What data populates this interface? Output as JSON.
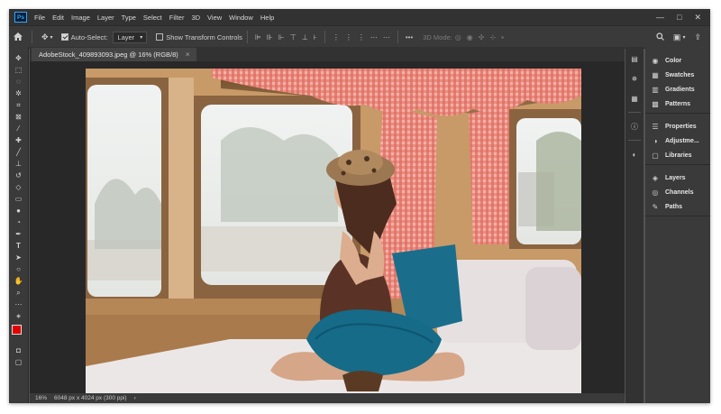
{
  "app": {
    "logo": "Ps"
  },
  "menu": [
    "File",
    "Edit",
    "Image",
    "Layer",
    "Type",
    "Select",
    "Filter",
    "3D",
    "View",
    "Window",
    "Help"
  ],
  "window_controls": {
    "minimize": "—",
    "maximize": "□",
    "close": "✕"
  },
  "options": {
    "home_icon": "home-icon",
    "move_tool_icon": "move-icon",
    "auto_select_label": "Auto-Select:",
    "auto_select_checked": true,
    "target": "Layer",
    "show_transform_label": "Show Transform Controls",
    "show_transform_checked": false,
    "more": "•••",
    "mode_3d_label": "3D Mode:"
  },
  "document": {
    "tab_title": "AdobeStock_409893093.jpeg @ 16% (RGB/8)",
    "tab_close": "×"
  },
  "status": {
    "zoom": "16%",
    "info": "6048 px x 4024 px (300 ppi)",
    "chevron": "›"
  },
  "tools": [
    "move-tool",
    "marquee-tool",
    "lasso-tool",
    "magic-wand-tool",
    "crop-tool",
    "frame-tool",
    "eyedropper-tool",
    "healing-brush-tool",
    "brush-tool",
    "clone-stamp-tool",
    "history-brush-tool",
    "eraser-tool",
    "gradient-tool",
    "blur-tool",
    "dodge-tool",
    "pen-tool",
    "type-tool",
    "path-selection-tool",
    "shape-tool",
    "hand-tool",
    "zoom-tool",
    "more-tools"
  ],
  "colors": {
    "foreground": "#e00000",
    "background": "#ffffff",
    "accent": "#31a8ff"
  },
  "panels": {
    "group1": [
      "Color",
      "Swatches",
      "Gradients",
      "Patterns"
    ],
    "group2": [
      "Properties",
      "Adjustme...",
      "Libraries"
    ],
    "group3": [
      "Layers",
      "Channels",
      "Paths"
    ]
  }
}
